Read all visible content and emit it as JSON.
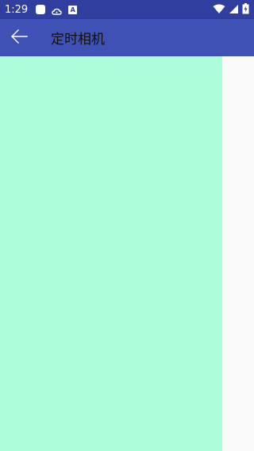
{
  "status_bar": {
    "time": "1:29",
    "notification_icons": [
      "app-square-icon",
      "cloud-icon",
      "a-badge-icon"
    ],
    "a_badge_text": "A",
    "system_icons": [
      "wifi-icon",
      "signal-icon",
      "battery-icon"
    ],
    "background_color": "#303f9f"
  },
  "app_bar": {
    "title": "定时相机",
    "back_icon": "arrow-back-icon",
    "background_color": "#3f51b5"
  },
  "content": {
    "preview_color": "#adfcda",
    "side_panel_color": "#fafafa"
  }
}
